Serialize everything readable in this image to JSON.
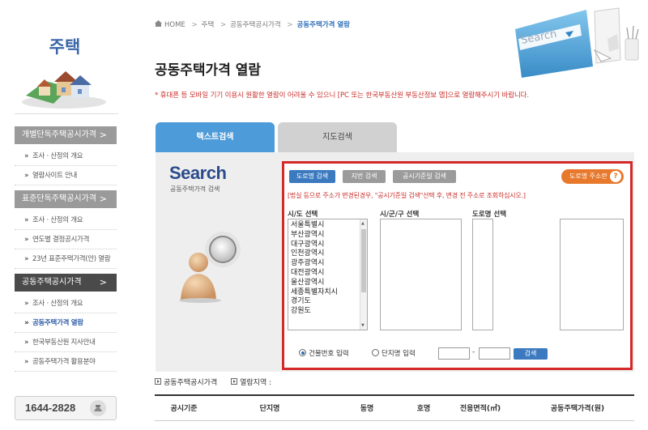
{
  "sidebar": {
    "title": "주택",
    "menu": [
      {
        "label": "개별단독주택공시가격",
        "active": false,
        "items": [
          "조사 · 산정의 개요",
          "열람사이트 안내"
        ]
      },
      {
        "label": "표준단독주택공시가격",
        "active": false,
        "items": [
          "조사 · 산정의 개요",
          "연도별 결정공시가격",
          "23년 표준주택가격(안) 열람"
        ]
      },
      {
        "label": "공동주택공시가격",
        "active": true,
        "items": [
          "조사 · 산정의 개요",
          "공동주택가격 열람",
          "한국부동산원 지사안내",
          "공동주택가격 활용분야"
        ],
        "active_item": 1
      }
    ],
    "phone": "1644-2828"
  },
  "breadcrumb": [
    "HOME",
    "주택",
    "공동주택공시가격",
    "공동주택가격 열람"
  ],
  "header_illustration_text": "Search",
  "page_title": "공동주택가격 열람",
  "notice": "* 휴대폰 등 모바일 기기 이용시 원활한 열람이 어려울 수 있으니 [PC 또는 한국부동산원 부동산정보 앱]으로 열람해주시기 바랍니다.",
  "tabs": {
    "text_search": "텍스트검색",
    "map_search": "지도검색"
  },
  "search": {
    "word": "Search",
    "subtitle": "공동주택가격 검색",
    "mode_buttons": {
      "road": "도로명 검색",
      "lot": "지번 검색",
      "date": "공시기준일 검색"
    },
    "road_address_btn": "도로명 주소란",
    "road_address_q": "?",
    "red_notice": "[법실 등으로 주소가 변경된경우, \"공시기준일 검색\"선택 후, 변경 전 주소로 조회하십시오.]",
    "labels": {
      "sido": "시/도 선택",
      "sigungu": "시/군/구 선택",
      "road": "도로명 선택"
    },
    "sido_list": [
      "서울특별시",
      "부산광역시",
      "대구광역시",
      "인천광역시",
      "광주광역시",
      "대전광역시",
      "울산광역시",
      "세종특별자치시",
      "경기도",
      "강원도"
    ],
    "radio_building": "건물번호 입력",
    "radio_complex": "단지명 입력",
    "dash": "-",
    "search_btn": "검색"
  },
  "results": {
    "header_label": "공동주택공시가격",
    "region_label": "열람지역 :",
    "columns": [
      "공시기준",
      "단지명",
      "동명",
      "호명",
      "전용면적(㎡)",
      "공동주택가격(원)"
    ]
  },
  "colors": {
    "accent_blue": "#4d9bd8",
    "notice_red": "#c9302c",
    "orange": "#e8782b",
    "highlight_border": "#d52828"
  }
}
